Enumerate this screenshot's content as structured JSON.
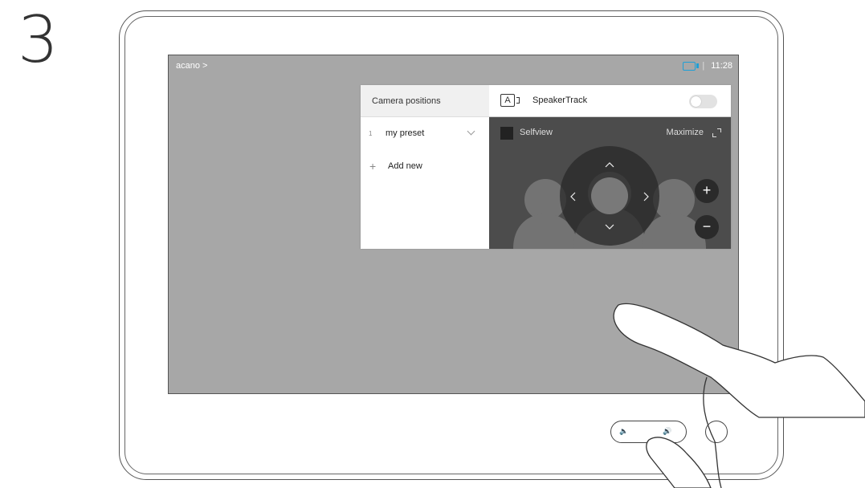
{
  "step": {
    "number": "3"
  },
  "device": {
    "header": {
      "breadcrumb": "acano >",
      "separator": "|",
      "time": "11:28",
      "camera_status_icon": "camera-icon",
      "accent_color": "#1e9fd6"
    },
    "camera_panel": {
      "title": "Camera positions",
      "presets": [
        {
          "index": "1",
          "name": "my preset"
        }
      ],
      "add_new_label": "Add new",
      "speakertrack_label": "SpeakerTrack",
      "speakertrack_icon_text": "A",
      "speakertrack_enabled": false,
      "selfview_label": "Selfview",
      "maximize_label": "Maximize",
      "zoom_in_label": "+",
      "zoom_out_label": "−"
    },
    "controls": {
      "volume_down_icon": "speaker-low-icon",
      "volume_up_icon": "speaker-high-icon"
    }
  }
}
